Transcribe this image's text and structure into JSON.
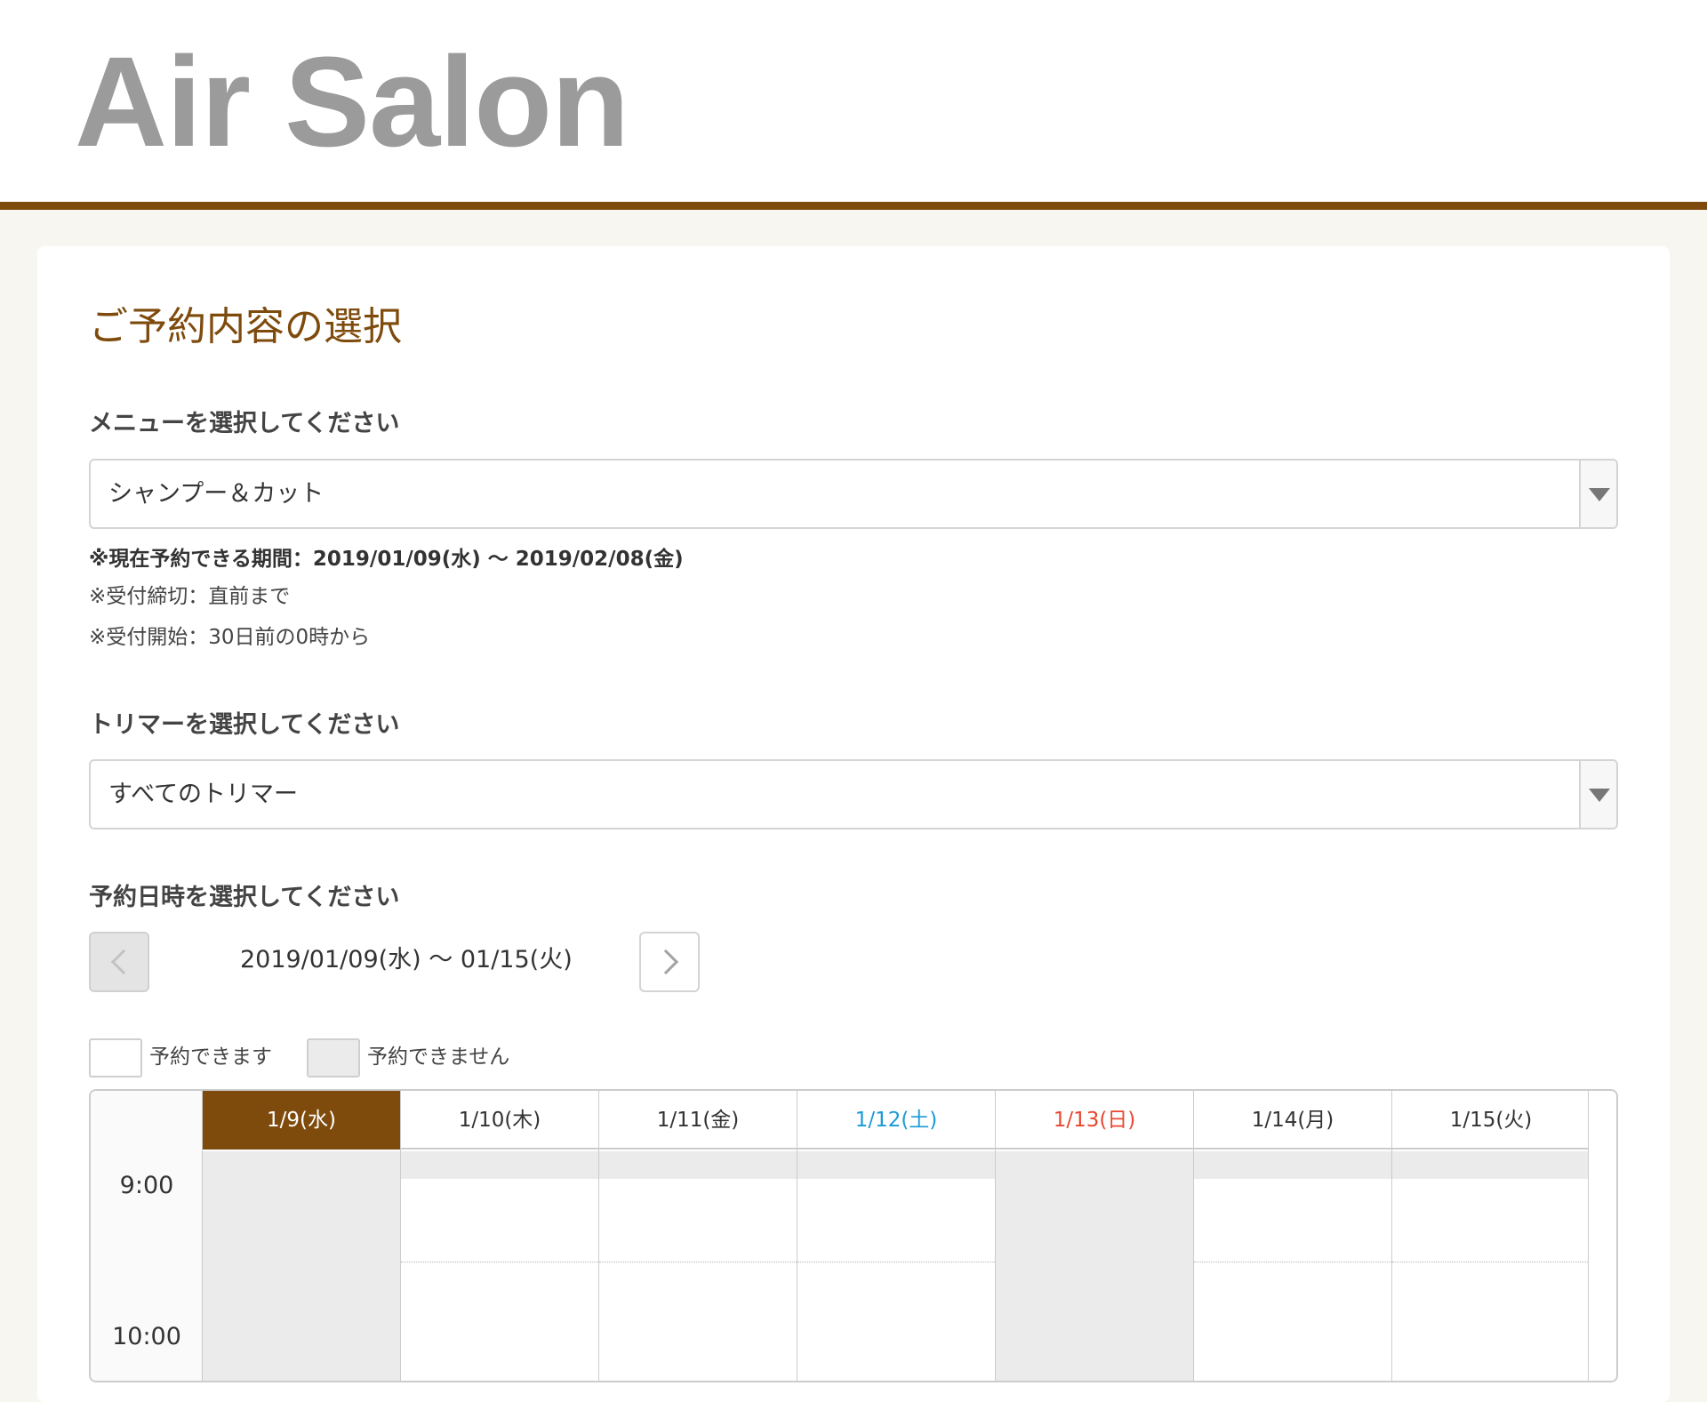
{
  "header": {
    "logo_text": "Air Salon"
  },
  "colors": {
    "brand": "#7e4b0d",
    "saturday": "#1a9ad6",
    "sunday": "#e8472f",
    "unavailable": "#ebebeb"
  },
  "page": {
    "title": "ご予約内容の選択"
  },
  "menu_section": {
    "label": "メニューを選択してください",
    "selected": "シャンプー＆カット",
    "notes": [
      "※現在予約できる期間：2019/01/09(水) 〜 2019/02/08(金)",
      "※受付締切：直前まで",
      "※受付開始：30日前の0時から"
    ]
  },
  "trimmer_section": {
    "label": "トリマーを選択してください",
    "selected": "すべてのトリマー"
  },
  "datetime_section": {
    "label": "予約日時を選択してください",
    "range": "2019/01/09(水) 〜 01/15(火)",
    "prev_icon": "chevron-left-icon",
    "next_icon": "chevron-right-icon",
    "legend": {
      "available": "予約できます",
      "unavailable": "予約できません"
    }
  },
  "calendar": {
    "times": [
      "9:00",
      "10:00"
    ],
    "days": [
      {
        "label": "1/9(水)",
        "today": true,
        "closed": true
      },
      {
        "label": "1/10(木)"
      },
      {
        "label": "1/11(金)"
      },
      {
        "label": "1/12(土)",
        "type": "sat"
      },
      {
        "label": "1/13(日)",
        "type": "sun",
        "closed": true
      },
      {
        "label": "1/14(月)"
      },
      {
        "label": "1/15(火)"
      }
    ]
  }
}
